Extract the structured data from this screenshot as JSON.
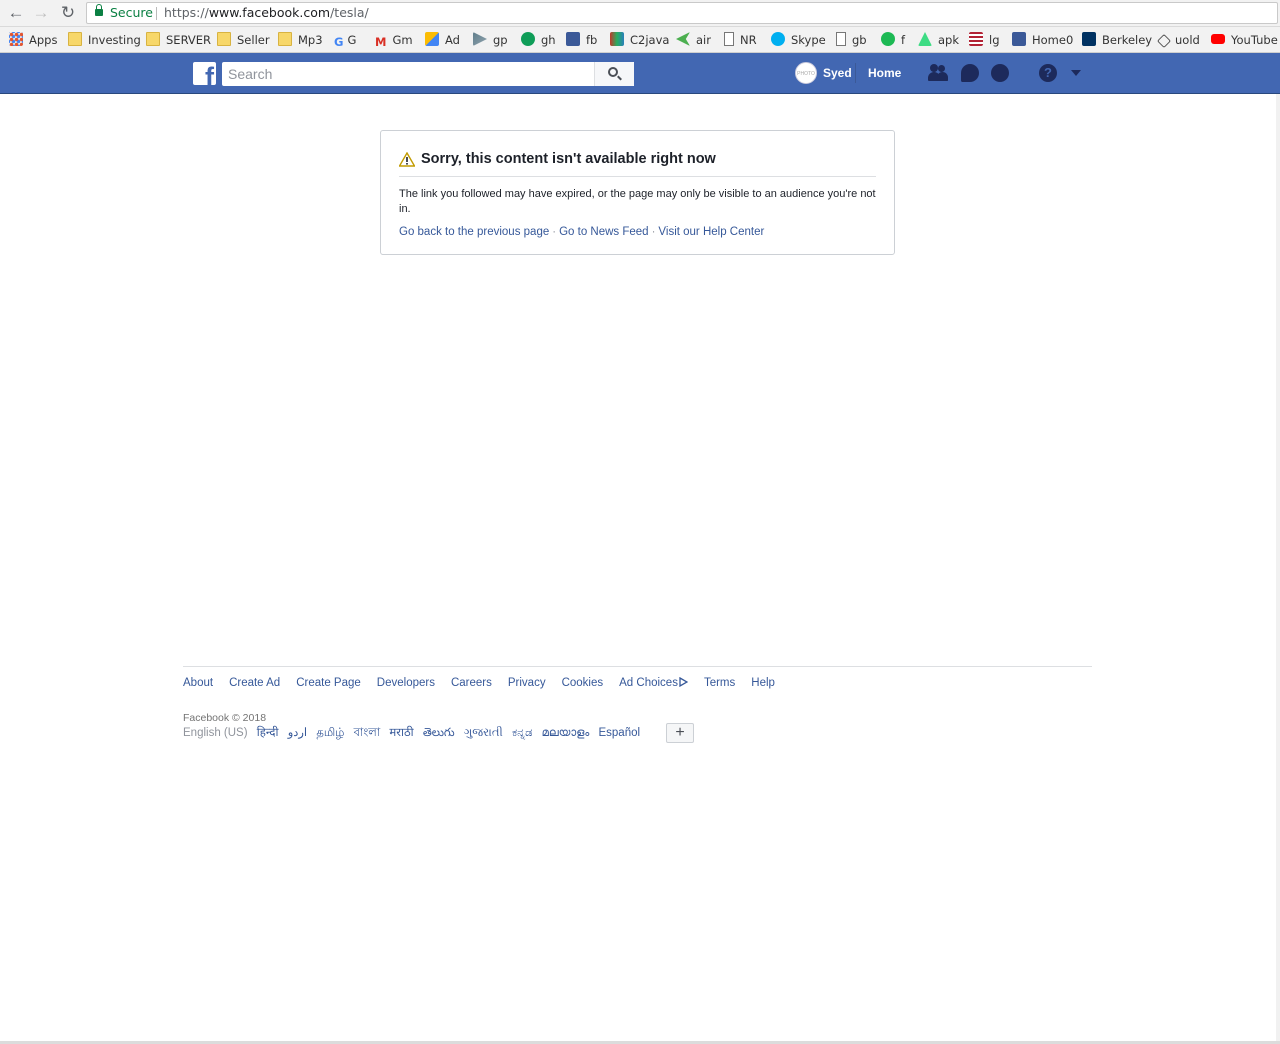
{
  "browser": {
    "secure_label": "Secure",
    "url_scheme": "https://",
    "url_host": "www.facebook.com",
    "url_path": "/tesla/",
    "bookmarks": [
      {
        "label": "Apps",
        "icon": "apps-grid-icon"
      },
      {
        "label": "Investing",
        "icon": "folder-icon"
      },
      {
        "label": "SERVER",
        "icon": "folder-icon"
      },
      {
        "label": "Seller",
        "icon": "folder-icon"
      },
      {
        "label": "Mp3",
        "icon": "folder-icon"
      },
      {
        "label": "G",
        "icon": "google-icon"
      },
      {
        "label": "Gm",
        "icon": "gmail-icon"
      },
      {
        "label": "Ad",
        "icon": "adwords-icon"
      },
      {
        "label": "gp",
        "icon": "play-store-icon"
      },
      {
        "label": "gh",
        "icon": "hangouts-icon"
      },
      {
        "label": "fb",
        "icon": "facebook-icon"
      },
      {
        "label": "C2java",
        "icon": "c2java-icon"
      },
      {
        "label": "air",
        "icon": "air-icon"
      },
      {
        "label": "NR",
        "icon": "document-icon"
      },
      {
        "label": "Skype",
        "icon": "skype-icon"
      },
      {
        "label": "gb",
        "icon": "document-icon"
      },
      {
        "label": "f",
        "icon": "play-icon"
      },
      {
        "label": "apk",
        "icon": "apk-icon"
      },
      {
        "label": "lg",
        "icon": "flag-icon"
      },
      {
        "label": "Home0",
        "icon": "facebook-icon"
      },
      {
        "label": "Berkeley",
        "icon": "berkeley-icon"
      },
      {
        "label": "uold",
        "icon": "vscode-icon"
      },
      {
        "label": "YouTube",
        "icon": "youtube-icon"
      }
    ]
  },
  "fb_header": {
    "logo": "f",
    "search_placeholder": "Search",
    "avatar_text": "PHOTO",
    "user_name": "Syed",
    "home_label": "Home"
  },
  "error": {
    "title": "Sorry, this content isn't available right now",
    "message": "The link you followed may have expired, or the page may only be visible to an audience you're not in.",
    "links": [
      "Go back to the previous page",
      "Go to News Feed",
      "Visit our Help Center"
    ],
    "separator": "·"
  },
  "footer": {
    "links": [
      "About",
      "Create Ad",
      "Create Page",
      "Developers",
      "Careers",
      "Privacy",
      "Cookies",
      "Ad Choices",
      "Terms",
      "Help"
    ],
    "copyright": "Facebook © 2018",
    "current_language": "English (US)",
    "languages": [
      "हिन्दी",
      "اردو",
      "தமிழ்",
      "বাংলা",
      "मराठी",
      "తెలుగు",
      "ગુજરાતી",
      "ಕನ್ನಡ",
      "മലയാളം",
      "Español"
    ],
    "more_label": "+"
  },
  "colors": {
    "fb_blue": "#4267b2",
    "link_blue": "#365899",
    "secure_green": "#0b8043"
  }
}
